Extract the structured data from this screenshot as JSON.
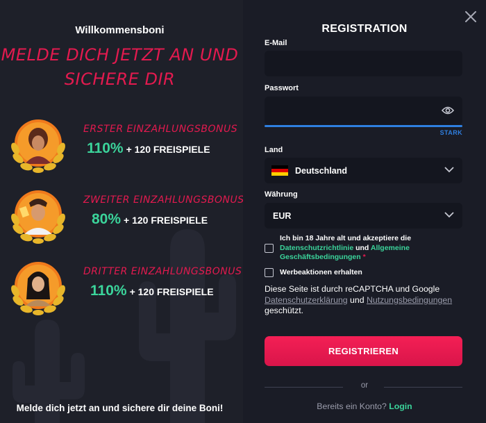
{
  "left": {
    "title": "Willkommensboni",
    "headline_line1": "Melde dich jetzt an und",
    "headline_line2": "sichere dir",
    "bonuses": [
      {
        "title": "Erster Einzahlungsbonus",
        "percent": "110%",
        "extra": "+ 120 FREISPIELE"
      },
      {
        "title": "Zweiter Einzahlungsbonus",
        "percent": "80%",
        "extra": "+ 120 FREISPIELE"
      },
      {
        "title": "Dritter Einzahlungsbonus",
        "percent": "110%",
        "extra": "+ 120 FREISPIELE"
      }
    ],
    "footer": "Melde dich jetzt an und sichere dir deine Boni!"
  },
  "form": {
    "title": "REGISTRATION",
    "email_label": "E-Mail",
    "email_value": "",
    "password_label": "Passwort",
    "password_value": "",
    "password_strength": "STARK",
    "country_label": "Land",
    "country_value": "Deutschland",
    "currency_label": "Währung",
    "currency_value": "EUR",
    "terms_text_1": "Ich bin 18 Jahre alt und akzeptiere die",
    "terms_link_1": "Datenschutzrichtlinie",
    "terms_and": "und",
    "terms_link_2": "Allgemeine Geschäftsbedingungen",
    "terms_asterisk": "*",
    "promo_text": "Werbeaktionen erhalten",
    "recaptcha_1": "Diese Seite ist durch reCAPTCHA und Google",
    "recaptcha_link_1": "Datenschutzerklärung",
    "recaptcha_and": "und",
    "recaptcha_link_2": "Nutzungsbedingungen",
    "recaptcha_end": "geschützt.",
    "submit": "REGISTRIEREN",
    "or": "or",
    "login_prompt": "Bereits ein Konto?",
    "login_link": "Login"
  },
  "colors": {
    "accent_red": "#e31a4f",
    "accent_green": "#3bd49b",
    "strength_blue": "#2f7fe0",
    "background": "#1c1e28"
  },
  "icons": [
    "close-icon",
    "eye-icon",
    "chevron-down-icon",
    "germany-flag-icon",
    "laurel-wreath-icon"
  ]
}
